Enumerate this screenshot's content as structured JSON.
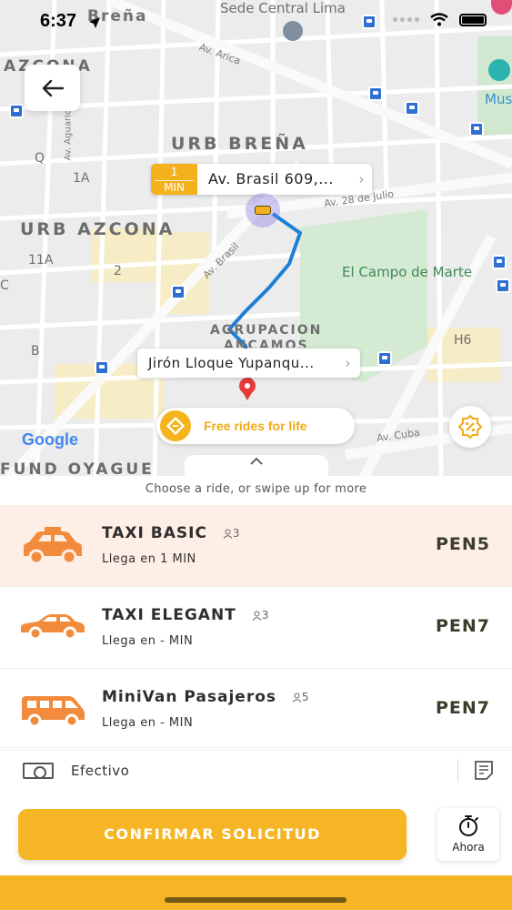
{
  "status_bar": {
    "time": "6:37"
  },
  "map": {
    "area_labels": [
      "Breña",
      "Sede Central Lima",
      "AZCONA",
      "URB BREÑA",
      "URB AZCONA",
      "AGRUPACION",
      "ANCAMOS",
      "FUND OYAGUE",
      "Mus"
    ],
    "street_labels": [
      "Av. Arica",
      "Av. Aguarico",
      "Av. Brasil",
      "Av. 28 de Julio",
      "Av. Cuba"
    ],
    "block_labels": [
      "Q",
      "1A",
      "11A",
      "2",
      "B",
      "C",
      "H6"
    ],
    "park_label": "El Campo de Marte",
    "attribution": "Google"
  },
  "route": {
    "pickup_eta_value": "1",
    "pickup_eta_unit": "MIN",
    "pickup_address": "Av. Brasil 609,...",
    "destination_address": "Jirón Lloque Yupanqu..."
  },
  "promo": {
    "label": "Free rides for life"
  },
  "sheet": {
    "hint": "Choose a ride, or swipe up for more"
  },
  "rides": [
    {
      "name": "TAXI BASIC",
      "seats": "3",
      "eta": "Llega en 1 MIN",
      "price": "PEN5",
      "selected": true
    },
    {
      "name": "TAXI ELEGANT",
      "seats": "3",
      "eta": "Llega en - MIN",
      "price": "PEN7",
      "selected": false
    },
    {
      "name": "MiniVan Pasajeros",
      "seats": "5",
      "eta": "Llega en - MIN",
      "price": "PEN7",
      "selected": false
    }
  ],
  "payment": {
    "method": "Efectivo"
  },
  "actions": {
    "confirm_label": "CONFIRMAR SOLICITUD",
    "schedule_label": "Ahora"
  },
  "colors": {
    "accent": "#f5b524",
    "route": "#1e7fd6",
    "selected_row": "#fdeee6",
    "car_orange": "#f28c3c"
  }
}
